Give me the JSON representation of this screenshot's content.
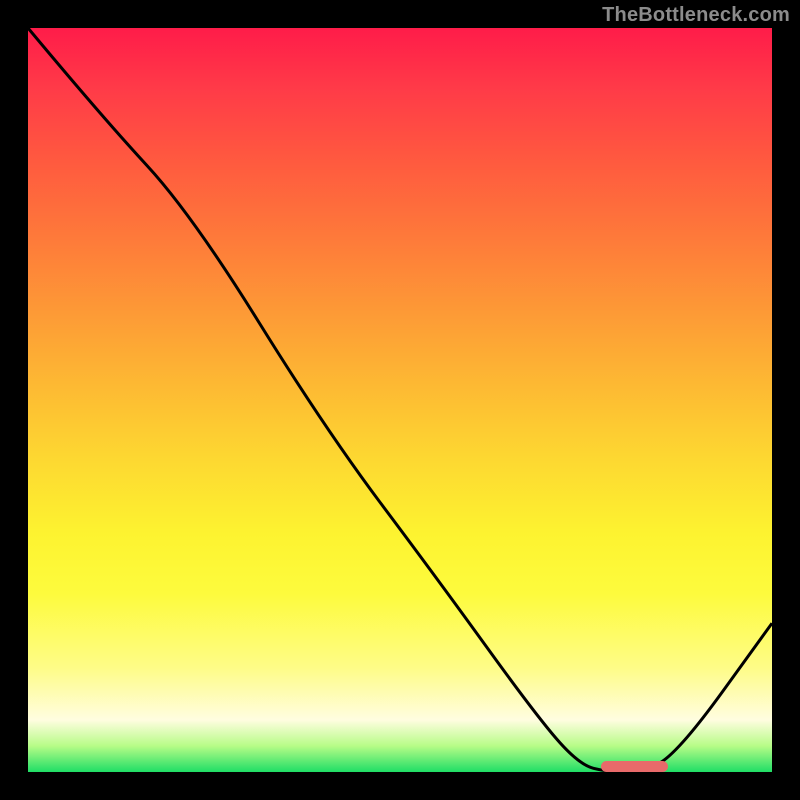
{
  "watermark": "TheBottleneck.com",
  "chart_data": {
    "type": "line",
    "title": "",
    "xlabel": "",
    "ylabel": "",
    "xlim": [
      0,
      100
    ],
    "ylim": [
      0,
      100
    ],
    "series": [
      {
        "name": "bottleneck-curve",
        "x": [
          0,
          10,
          22,
          40,
          55,
          68,
          74,
          78,
          82,
          87,
          100
        ],
        "y": [
          100,
          88,
          75,
          46,
          26,
          8,
          1,
          0,
          0,
          2,
          20
        ]
      }
    ],
    "marker_range_x": [
      77,
      86
    ],
    "colors": {
      "top": "#ff1c49",
      "bottom": "#1fde66",
      "marker": "#e86a6a",
      "curve": "#000000"
    }
  }
}
